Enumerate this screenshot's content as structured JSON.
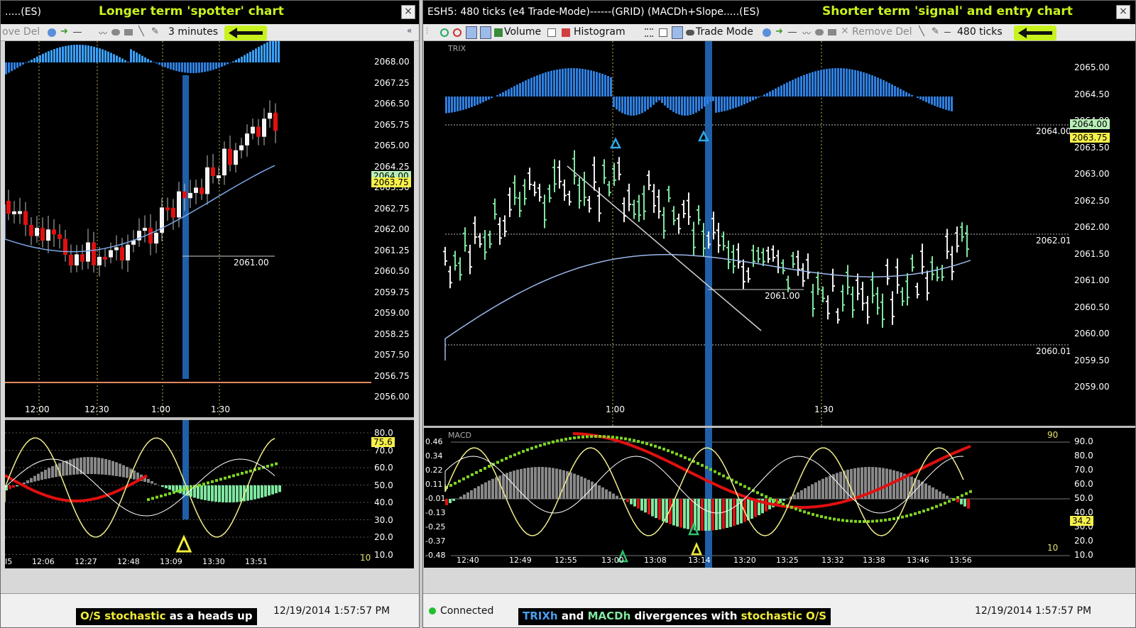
{
  "left": {
    "title": ".....(ES)",
    "annotation": "Longer  term 'spotter' chart",
    "close": "×",
    "toolbar": {
      "remove_del": "ove Del",
      "interval": "3 minutes"
    },
    "price_axis": [
      "2068.00",
      "2067.25",
      "2066.50",
      "2065.75",
      "2065.00",
      "2064.25",
      "2063.50",
      "2062.75",
      "2062.00",
      "2061.25",
      "2060.50",
      "2059.75",
      "2059.00",
      "2058.25",
      "2057.50",
      "2056.75",
      "2056.00"
    ],
    "price_badges": {
      "top": "2064.00",
      "bottom": "2063.75"
    },
    "level_label": "2061.00",
    "time_labels": [
      "12:00",
      "12:30",
      "1:00",
      "1:30"
    ],
    "bottom_times": [
      "I5",
      "12:06",
      "12:27",
      "12:48",
      "13:09",
      "13:30",
      "13:51"
    ],
    "osc_axis": [
      "80.0",
      "70.0",
      "60.0",
      "50.0",
      "40.0",
      "30.0",
      "20.0",
      "10.0"
    ],
    "osc_badge": "75.6",
    "level_10": "10",
    "caption_parts": [
      "O/S stochastic",
      " as a heads up"
    ],
    "timestamp": "12/19/2014 1:57:57 PM"
  },
  "right": {
    "title": "ESH5: 480 ticks (e4 Trade-Mode)------(GRID) (MACDh+Slope.....(ES)",
    "annotation": "Shorter term 'signal' and entry chart",
    "close": "×",
    "toolbar": {
      "volume": "Volume",
      "histogram": "Histogram",
      "trade_mode": "Trade Mode",
      "remove_del": "Remove Del",
      "interval": "480 ticks"
    },
    "trix_label": "TRIX",
    "macd_label": "MACD",
    "price_axis": [
      "2065.00",
      "2064.50",
      "2064.00",
      "2063.50",
      "2063.00",
      "2062.50",
      "2062.00",
      "2061.50",
      "2061.00",
      "2060.50",
      "2060.00",
      "2059.50",
      "2059.00"
    ],
    "price_badges": {
      "top": "2064.00",
      "bottom": "2063.75"
    },
    "guide_labels": [
      "2064.00",
      "2062.01",
      "2060.01"
    ],
    "level_label": "2061.00",
    "time_labels": [
      "1:00",
      "1:30"
    ],
    "bottom_times": [
      "12:40",
      "12:49",
      "12:55",
      "13:00",
      "13:08",
      "13:14",
      "13:20",
      "13:25",
      "13:32",
      "13:38",
      "13:46",
      "13:56"
    ],
    "macd_axis_left": [
      "0.46",
      "0.34",
      "0.22",
      "0.11",
      "-0.01",
      "-0.13",
      "-0.25",
      "-0.37",
      "-0.48"
    ],
    "osc_axis": [
      "90.0",
      "80.0",
      "70.0",
      "60.0",
      "50.0",
      "40.0",
      "30.0",
      "20.0",
      "10.0"
    ],
    "level_90": "90",
    "level_10": "10",
    "osc_badge": "34.2",
    "status": "Connected",
    "caption_parts": [
      "TRIXh",
      " and ",
      "MACDh",
      " divergences with ",
      "stochastic O/S"
    ],
    "timestamp": "12/19/2014 1:57:57 PM"
  },
  "colors": {
    "bull_green": "#7fe6a0",
    "bear_red": "#e01010",
    "trix_blue": "#2f86e6",
    "highlight_blue": "#1f5fa8",
    "annotation_lime": "#c8f21e",
    "stoch_yellow": "#f2ee8a",
    "dot_green": "#7ed321"
  }
}
